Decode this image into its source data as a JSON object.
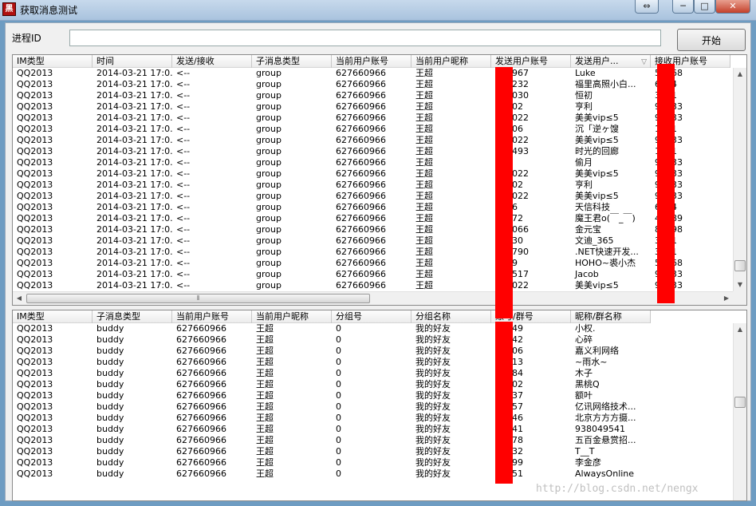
{
  "window": {
    "title": "获取消息测试",
    "icon_label": "黑",
    "restore_glyph": "⇔",
    "minimize_glyph": "─",
    "maximize_glyph": "□",
    "close_glyph": "✕"
  },
  "form": {
    "pid_label": "进程ID",
    "pid_value": "",
    "start_label": "开始"
  },
  "messages": {
    "columns": [
      "IM类型",
      "时间",
      "发送/接收",
      "子消息类型",
      "当前用户账号",
      "当前用户昵称",
      "发送用户账号",
      "发送用户...",
      "接收用户账号"
    ],
    "sort_icon": "▽",
    "hscroll_grip": "⦀",
    "rows": [
      [
        "QQ2013",
        "2014-03-21 17:0...",
        "<--",
        "group",
        "627660966",
        "王超",
        "383967",
        "Luke",
        "54668"
      ],
      [
        "QQ2013",
        "2014-03-21 17:0...",
        "<--",
        "group",
        "627660966",
        "王超",
        "752232",
        "福里高照小白...",
        "6044"
      ],
      [
        "QQ2013",
        "2014-03-21 17:0...",
        "<--",
        "group",
        "627660966",
        "王超",
        "906030",
        "恒初",
        "3241"
      ],
      [
        "QQ2013",
        "2014-03-21 17:0...",
        "<--",
        "group",
        "627660966",
        "王超",
        "44002",
        "亨利",
        "91433"
      ],
      [
        "QQ2013",
        "2014-03-21 17:0...",
        "<--",
        "group",
        "627660966",
        "王超",
        "690022",
        "美美vip≤5",
        "91433"
      ],
      [
        "QQ2013",
        "2014-03-21 17:0...",
        "<--",
        "group",
        "627660966",
        "王超",
        "21306",
        "沉「逆ヶ馊",
        "1871"
      ],
      [
        "QQ2013",
        "2014-03-21 17:0...",
        "<--",
        "group",
        "627660966",
        "王超",
        "690022",
        "美美vip≤5",
        "91433"
      ],
      [
        "QQ2013",
        "2014-03-21 17:0...",
        "<--",
        "group",
        "627660966",
        "王超",
        "899493",
        "时光的回廊",
        "1871"
      ],
      [
        "QQ2013",
        "2014-03-21 17:0...",
        "<--",
        "group",
        "627660966",
        "王超",
        "605",
        "偷月",
        "91433"
      ],
      [
        "QQ2013",
        "2014-03-21 17:0...",
        "<--",
        "group",
        "627660966",
        "王超",
        "690022",
        "美美vip≤5",
        "91433"
      ],
      [
        "QQ2013",
        "2014-03-21 17:0...",
        "<--",
        "group",
        "627660966",
        "王超",
        "44002",
        "亨利",
        "91433"
      ],
      [
        "QQ2013",
        "2014-03-21 17:0...",
        "<--",
        "group",
        "627660966",
        "王超",
        "690022",
        "美美vip≤5",
        "91433"
      ],
      [
        "QQ2013",
        "2014-03-21 17:0...",
        "<--",
        "group",
        "627660966",
        "王超",
        "4616",
        "天信科技",
        "6044"
      ],
      [
        "QQ2013",
        "2014-03-21 17:0...",
        "<--",
        "group",
        "627660966",
        "王超",
        "54872",
        "魔王君o(￣_￣)",
        "47389"
      ],
      [
        "QQ2013",
        "2014-03-21 17:0...",
        "<--",
        "group",
        "627660966",
        "王超",
        "763066",
        "金元宝",
        "82198"
      ],
      [
        "QQ2013",
        "2014-03-21 17:0...",
        "<--",
        "group",
        "627660966",
        "王超",
        "36130",
        "文迪_365",
        "3241"
      ],
      [
        "QQ2013",
        "2014-03-21 17:0...",
        "<--",
        "group",
        "627660966",
        "王超",
        "690790",
        ".NET快速开发...",
        "3241"
      ],
      [
        "QQ2013",
        "2014-03-21 17:0...",
        "<--",
        "group",
        "627660966",
        "王超",
        "0739",
        "HOHO~裘小杰",
        "54668"
      ],
      [
        "QQ2013",
        "2014-03-21 17:0...",
        "<--",
        "group",
        "627660966",
        "王超",
        "684517",
        "Jacob",
        "91433"
      ],
      [
        "QQ2013",
        "2014-03-21 17:0...",
        "<--",
        "group",
        "627660966",
        "王超",
        "690022",
        "美美vip≤5",
        "91433"
      ]
    ]
  },
  "contacts": {
    "columns": [
      "IM类型",
      "子消息类型",
      "当前用户账号",
      "当前用户昵称",
      "分组号",
      "分组名称",
      "账号/群号",
      "昵称/群名称"
    ],
    "rows": [
      [
        "QQ2013",
        "buddy",
        "627660966",
        "王超",
        "0",
        "我的好友",
        "92549",
        "小权."
      ],
      [
        "QQ2013",
        "buddy",
        "627660966",
        "王超",
        "0",
        "我的好友",
        "12942",
        "心碎"
      ],
      [
        "QQ2013",
        "buddy",
        "627660966",
        "王超",
        "0",
        "我的好友",
        "27806",
        "嘉义利网络"
      ],
      [
        "QQ2013",
        "buddy",
        "627660966",
        "王超",
        "0",
        "我的好友",
        "38613",
        "~雨水~"
      ],
      [
        "QQ2013",
        "buddy",
        "627660966",
        "王超",
        "0",
        "我的好友",
        "09784",
        "木子"
      ],
      [
        "QQ2013",
        "buddy",
        "627660966",
        "王超",
        "0",
        "我的好友",
        "57502",
        "黑桃Q"
      ],
      [
        "QQ2013",
        "buddy",
        "627660966",
        "王超",
        "0",
        "我的好友",
        "32937",
        "额叶"
      ],
      [
        "QQ2013",
        "buddy",
        "627660966",
        "王超",
        "0",
        "我的好友",
        "34457",
        "亿讯网络技术..."
      ],
      [
        "QQ2013",
        "buddy",
        "627660966",
        "王超",
        "0",
        "我的好友",
        "37646",
        "北京方方方摄..."
      ],
      [
        "QQ2013",
        "buddy",
        "627660966",
        "王超",
        "0",
        "我的好友",
        "49541",
        "938049541"
      ],
      [
        "QQ2013",
        "buddy",
        "627660966",
        "王超",
        "0",
        "我的好友",
        "55978",
        "五百金悬赏招..."
      ],
      [
        "QQ2013",
        "buddy",
        "627660966",
        "王超",
        "0",
        "我的好友",
        "41832",
        "T__T"
      ],
      [
        "QQ2013",
        "buddy",
        "627660966",
        "王超",
        "0",
        "我的好友",
        "50499",
        "李金彦"
      ],
      [
        "QQ2013",
        "buddy",
        "627660966",
        "王超",
        "0",
        "我的好友",
        "36951",
        "AlwaysOnline"
      ]
    ]
  },
  "watermark": "http://blog.csdn.net/nengx",
  "colors": {
    "redaction": "#ff0000",
    "window_frame": "#6e9cc2"
  }
}
